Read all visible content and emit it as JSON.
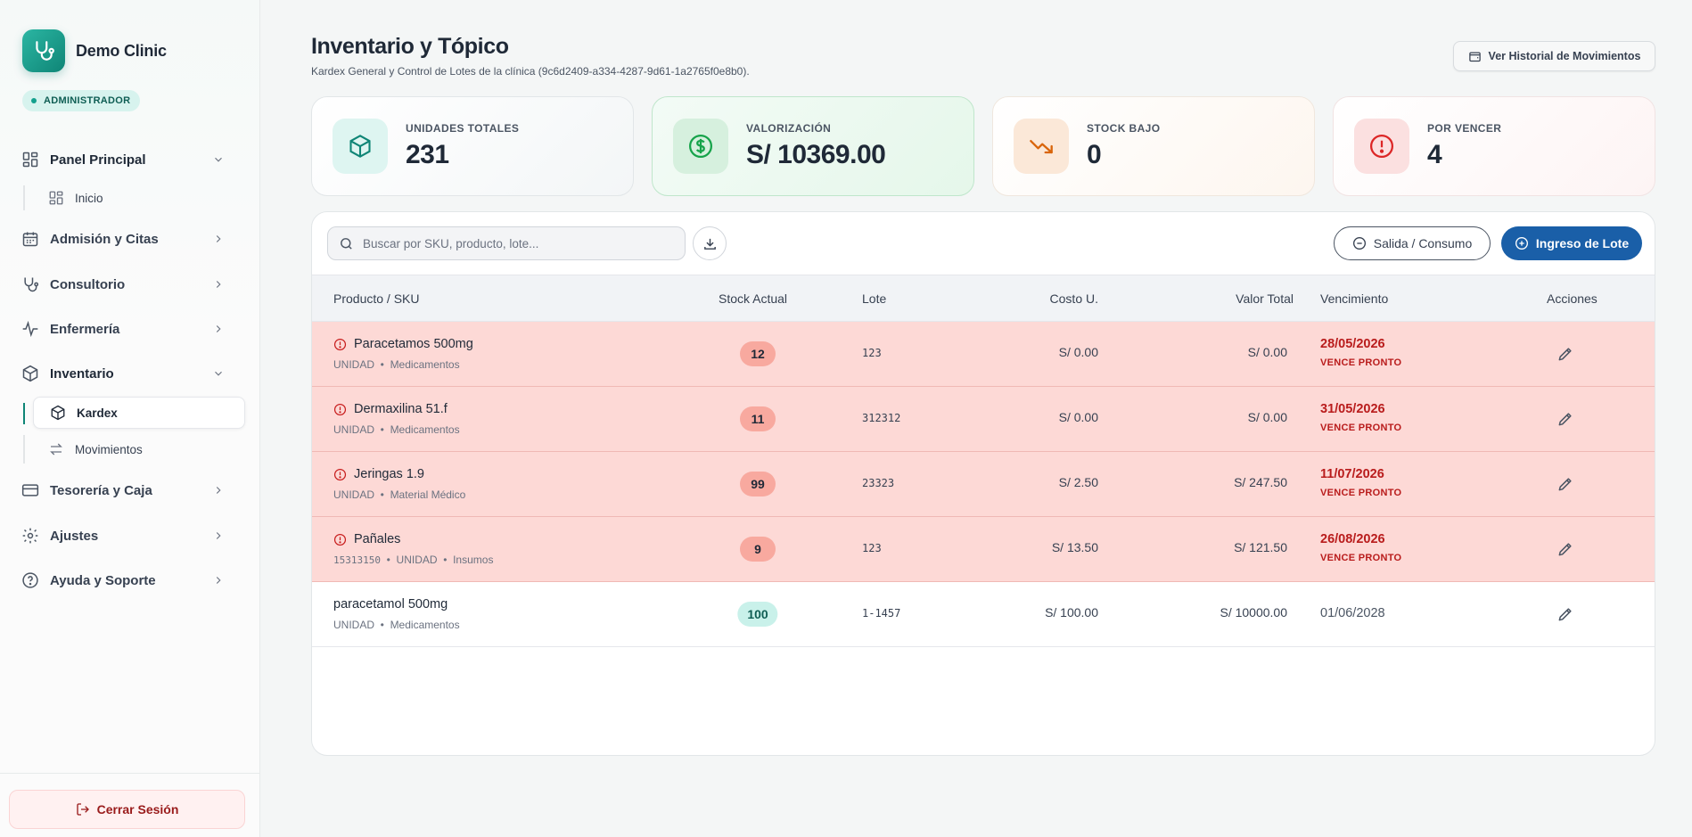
{
  "brand": {
    "name": "Demo Clinic",
    "role": "ADMINISTRADOR"
  },
  "nav": [
    {
      "label": "Panel Principal",
      "icon": "dashboard-icon",
      "expanded": true
    },
    {
      "label": "Admisión y Citas",
      "icon": "calendar-icon"
    },
    {
      "label": "Consultorio",
      "icon": "stethoscope-icon"
    },
    {
      "label": "Enfermería",
      "icon": "activity-icon"
    },
    {
      "label": "Inventario",
      "icon": "box-icon",
      "expanded": true
    },
    {
      "label": "Tesorería y Caja",
      "icon": "credit-card-icon"
    },
    {
      "label": "Ajustes",
      "icon": "gear-icon"
    },
    {
      "label": "Ayuda y Soporte",
      "icon": "help-icon"
    }
  ],
  "subnav": {
    "panel": [
      {
        "label": "Inicio",
        "icon": "dashboard-icon"
      }
    ],
    "inventario": [
      {
        "label": "Kardex",
        "icon": "box-icon",
        "selected": true
      },
      {
        "label": "Movimientos",
        "icon": "swap-icon"
      }
    ]
  },
  "logout": {
    "label": "Cerrar Sesión"
  },
  "header": {
    "title": "Inventario y Tópico",
    "subtitle": "Kardex General y Control de Lotes de la clínica (9c6d2409-a334-4287-9d61-1a2765f0e8b0).",
    "history_button": "Ver Historial de Movimientos"
  },
  "stats": [
    {
      "label": "UNIDADES TOTALES",
      "value": "231",
      "icon": "box-icon"
    },
    {
      "label": "VALORIZACIÓN",
      "value": "S/ 10369.00",
      "icon": "dollar-icon"
    },
    {
      "label": "STOCK BAJO",
      "value": "0",
      "icon": "trending-down-icon"
    },
    {
      "label": "POR VENCER",
      "value": "4",
      "icon": "alert-circle-icon"
    }
  ],
  "toolbar": {
    "search_placeholder": "Buscar por SKU, producto, lote...",
    "exit_button": "Salida / Consumo",
    "entry_button": "Ingreso de Lote"
  },
  "table": {
    "columns": [
      "Producto / SKU",
      "Stock Actual",
      "Lote",
      "Costo U.",
      "Valor Total",
      "Vencimiento",
      "Acciones"
    ],
    "rows": [
      {
        "name": "Paracetamos 500mg",
        "sku": "",
        "unit": "UNIDAD",
        "category": "Medicamentos",
        "stock": "12",
        "lote": "123",
        "cost": "S/ 0.00",
        "total": "S/ 0.00",
        "expiry": "28/05/2026",
        "flag": "VENCE PRONTO",
        "alert": true
      },
      {
        "name": "Dermaxilina 51.f",
        "sku": "",
        "unit": "UNIDAD",
        "category": "Medicamentos",
        "stock": "11",
        "lote": "312312",
        "cost": "S/ 0.00",
        "total": "S/ 0.00",
        "expiry": "31/05/2026",
        "flag": "VENCE PRONTO",
        "alert": true
      },
      {
        "name": "Jeringas 1.9",
        "sku": "",
        "unit": "UNIDAD",
        "category": "Material Médico",
        "stock": "99",
        "lote": "23323",
        "cost": "S/ 2.50",
        "total": "S/ 247.50",
        "expiry": "11/07/2026",
        "flag": "VENCE PRONTO",
        "alert": true
      },
      {
        "name": "Pañales",
        "sku": "15313150",
        "unit": "UNIDAD",
        "category": "Insumos",
        "stock": "9",
        "lote": "123",
        "cost": "S/ 13.50",
        "total": "S/ 121.50",
        "expiry": "26/08/2026",
        "flag": "VENCE PRONTO",
        "alert": true
      },
      {
        "name": "paracetamol 500mg",
        "sku": "",
        "unit": "UNIDAD",
        "category": "Medicamentos",
        "stock": "100",
        "lote": "1-1457",
        "cost": "S/ 100.00",
        "total": "S/ 10000.00",
        "expiry": "01/06/2028",
        "flag": "",
        "alert": false
      }
    ]
  },
  "colors": {
    "accent": "#0f8576",
    "primary_button": "#1a5fa8",
    "alert_row": "#fdd9d6",
    "alert_text": "#b91c1c"
  }
}
